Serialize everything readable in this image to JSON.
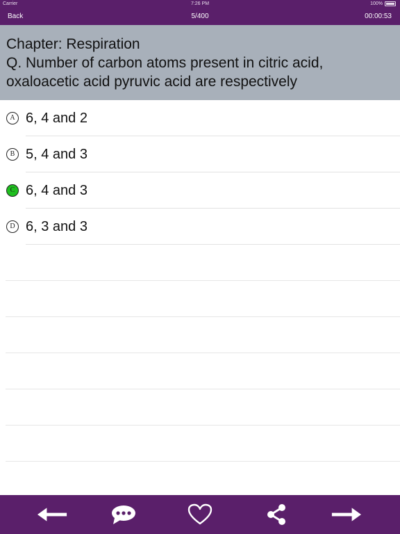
{
  "status_bar": {
    "carrier": "Carrier",
    "time": "7:26 PM",
    "battery": "100%"
  },
  "nav": {
    "back_label": "Back",
    "progress": "5/400",
    "timer": "00:00:53"
  },
  "question": {
    "chapter": "Chapter: Respiration",
    "text": "Q. Number of carbon atoms present in citric acid, oxaloacetic acid pyruvic acid are respectively"
  },
  "options": [
    {
      "letter": "A",
      "text": "6, 4 and 2",
      "selected": false
    },
    {
      "letter": "B",
      "text": "5, 4 and 3",
      "selected": false
    },
    {
      "letter": "C",
      "text": "6, 4 and 3",
      "selected": true
    },
    {
      "letter": "D",
      "text": "6, 3 and 3",
      "selected": false
    }
  ],
  "toolbar": {
    "icons": [
      "arrow-left-icon",
      "comment-icon",
      "heart-icon",
      "share-icon",
      "arrow-right-icon"
    ]
  },
  "colors": {
    "bar": "#5a1f6a",
    "question_bg": "#a8b0ba",
    "correct": "#1fbf1f"
  }
}
